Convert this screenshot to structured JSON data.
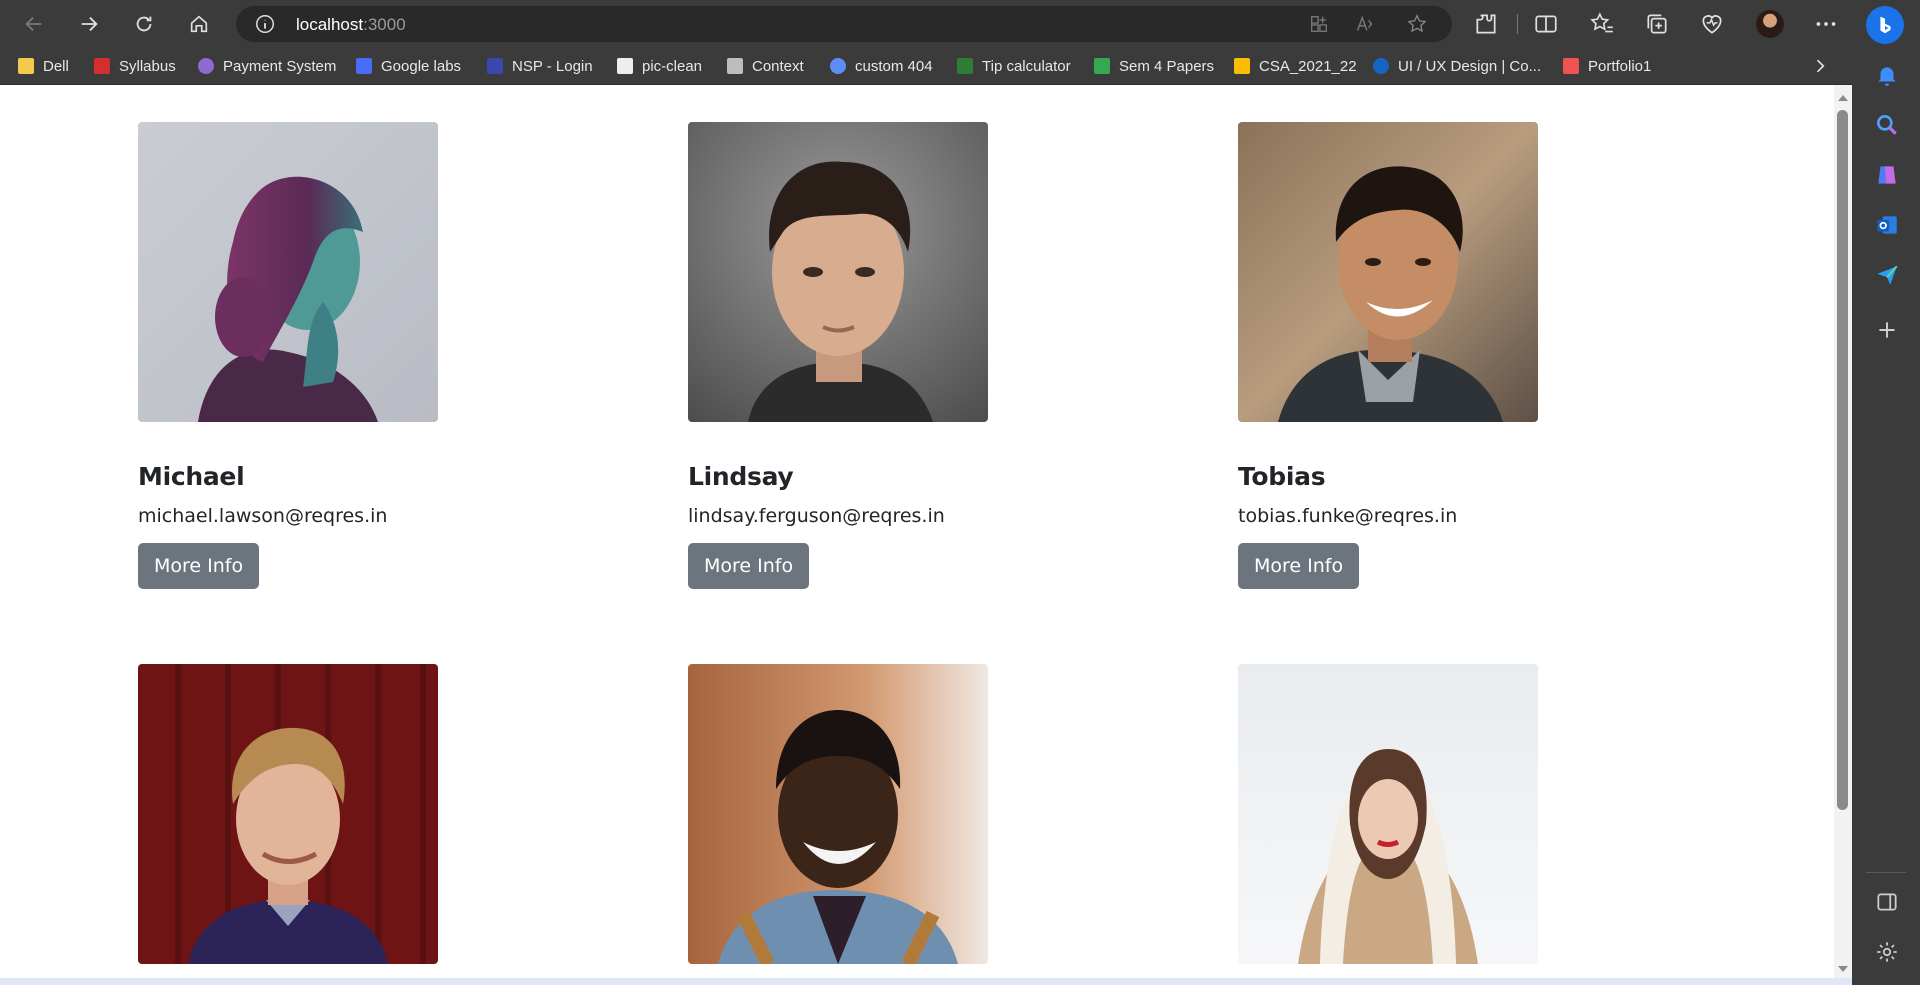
{
  "browser": {
    "url_host": "localhost",
    "url_port": ":3000"
  },
  "bookmarks": [
    {
      "label": "Dell",
      "color": "#f2c94c"
    },
    {
      "label": "Syllabus",
      "color": "#d32f2f"
    },
    {
      "label": "Payment System",
      "color": "#8e6bd1"
    },
    {
      "label": "Google labs",
      "color": "#4a6cf7"
    },
    {
      "label": "NSP - Login",
      "color": "#3949ab"
    },
    {
      "label": "pic-clean",
      "color": "#eeeeee"
    },
    {
      "label": "Context",
      "color": "#bdbdbd"
    },
    {
      "label": "custom 404",
      "color": "#5c8df6"
    },
    {
      "label": "Tip calculator",
      "color": "#2e7d32"
    },
    {
      "label": "Sem 4 Papers",
      "color": "#34a853"
    },
    {
      "label": "CSA_2021_22",
      "color": "#fbbc04"
    },
    {
      "label": "UI / UX Design | Co...",
      "color": "#1565c0"
    },
    {
      "label": "Portfolio1",
      "color": "#ef5350"
    }
  ],
  "users": [
    {
      "name": "Michael",
      "email": "michael.lawson@reqres.in",
      "button": "More Info"
    },
    {
      "name": "Lindsay",
      "email": "lindsay.ferguson@reqres.in",
      "button": "More Info"
    },
    {
      "name": "Tobias",
      "email": "tobias.funke@reqres.in",
      "button": "More Info"
    },
    {
      "name": "",
      "email": "",
      "button": ""
    },
    {
      "name": "",
      "email": "",
      "button": ""
    },
    {
      "name": "",
      "email": "",
      "button": ""
    }
  ],
  "colors": {
    "button_bg": "#6c757d",
    "chrome_bg": "#3b3b3b",
    "text": "#212529"
  }
}
